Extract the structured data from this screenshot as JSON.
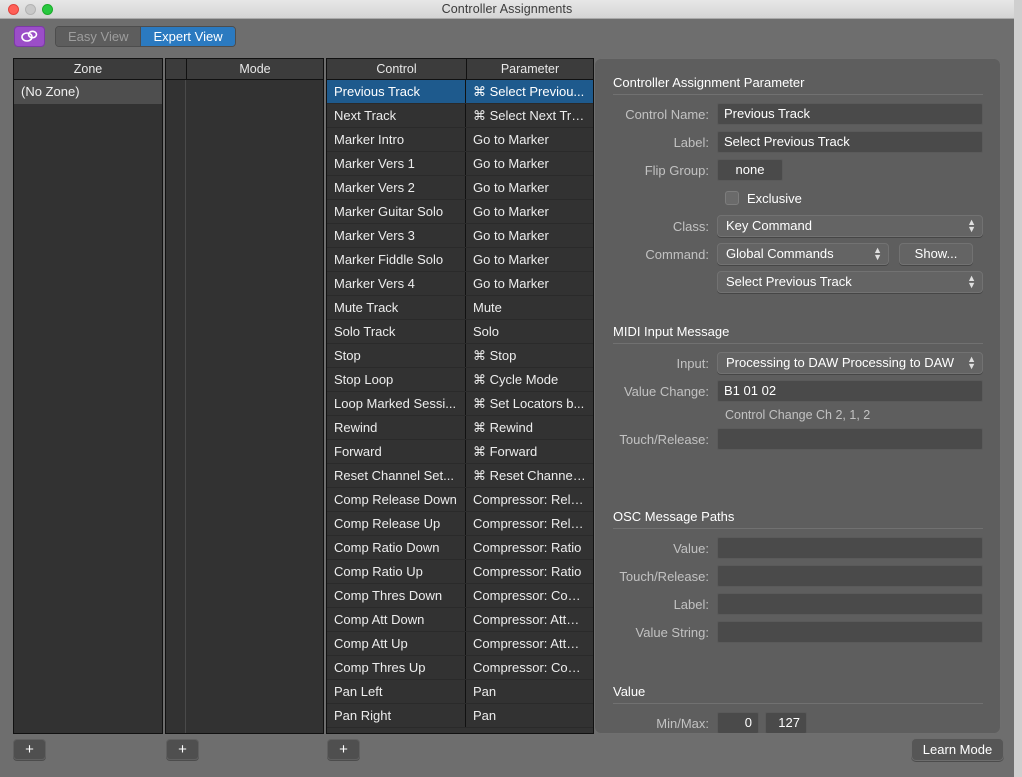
{
  "window": {
    "title": "Controller Assignments"
  },
  "toolbar": {
    "link_icon": "link-icon",
    "easy_view": "Easy View",
    "expert_view": "Expert View"
  },
  "zone_table": {
    "header": "Zone",
    "rows": [
      "(No Zone)"
    ]
  },
  "mode_table": {
    "header": "Mode",
    "rows": []
  },
  "control_table": {
    "headers": {
      "control": "Control",
      "parameter": "Parameter"
    },
    "rows": [
      {
        "control": "Previous Track",
        "parameter": "⌘ Select Previou...",
        "selected": true
      },
      {
        "control": "Next Track",
        "parameter": "⌘ Select Next Tra..."
      },
      {
        "control": "Marker Intro",
        "parameter": "Go to Marker"
      },
      {
        "control": "Marker Vers 1",
        "parameter": "Go to Marker"
      },
      {
        "control": "Marker Vers 2",
        "parameter": "Go to Marker"
      },
      {
        "control": "Marker Guitar Solo",
        "parameter": "Go to Marker"
      },
      {
        "control": "Marker Vers 3",
        "parameter": "Go to Marker"
      },
      {
        "control": "Marker Fiddle Solo",
        "parameter": "Go to Marker"
      },
      {
        "control": "Marker Vers 4",
        "parameter": "Go to Marker"
      },
      {
        "control": "Mute Track",
        "parameter": "Mute"
      },
      {
        "control": "Solo Track",
        "parameter": "Solo"
      },
      {
        "control": "Stop",
        "parameter": "⌘ Stop"
      },
      {
        "control": "Stop Loop",
        "parameter": "⌘ Cycle Mode"
      },
      {
        "control": "Loop Marked Sessi...",
        "parameter": "⌘ Set Locators b..."
      },
      {
        "control": "Rewind",
        "parameter": "⌘ Rewind"
      },
      {
        "control": "Forward",
        "parameter": "⌘ Forward"
      },
      {
        "control": "Reset Channel Set...",
        "parameter": "⌘ Reset Channel..."
      },
      {
        "control": "Comp Release Down",
        "parameter": "Compressor: Rele..."
      },
      {
        "control": "Comp Release Up",
        "parameter": "Compressor: Rele..."
      },
      {
        "control": "Comp Ratio Down",
        "parameter": "Compressor: Ratio"
      },
      {
        "control": "Comp Ratio Up",
        "parameter": "Compressor: Ratio"
      },
      {
        "control": "Comp Thres Down",
        "parameter": "Compressor: Com..."
      },
      {
        "control": "Comp Att Down",
        "parameter": "Compressor: Attack"
      },
      {
        "control": "Comp Att Up",
        "parameter": "Compressor: Attack"
      },
      {
        "control": "Comp Thres Up",
        "parameter": "Compressor: Com..."
      },
      {
        "control": "Pan Left",
        "parameter": "Pan"
      },
      {
        "control": "Pan Right",
        "parameter": "Pan"
      }
    ]
  },
  "panel": {
    "assignment": {
      "title": "Controller Assignment Parameter",
      "control_name_label": "Control Name:",
      "control_name_value": "Previous Track",
      "label_label": "Label:",
      "label_value": "Select Previous Track",
      "flip_group_label": "Flip Group:",
      "flip_group_value": "none",
      "exclusive_label": "Exclusive",
      "class_label": "Class:",
      "class_value": "Key Command",
      "command_label": "Command:",
      "command_value": "Global Commands",
      "show_button": "Show...",
      "command_detail_value": "Select Previous Track"
    },
    "midi": {
      "title": "MIDI Input Message",
      "input_label": "Input:",
      "input_value": "Processing to DAW Processing to DAW",
      "value_change_label": "Value Change:",
      "value_change_value": "B1 01 02",
      "value_change_hint": "Control Change Ch 2, 1, 2",
      "touch_release_label": "Touch/Release:",
      "touch_release_value": ""
    },
    "osc": {
      "title": "OSC Message Paths",
      "value_label": "Value:",
      "value_value": "",
      "touch_release_label": "Touch/Release:",
      "touch_release_value": "",
      "label_label": "Label:",
      "label_value": "",
      "value_string_label": "Value String:",
      "value_string_value": ""
    },
    "value": {
      "title": "Value",
      "minmax_label": "Min/Max:",
      "min": "0",
      "max": "127"
    }
  },
  "bottom": {
    "add_zone": "+",
    "add_mode": "+",
    "add_control": "+",
    "learn_mode": "Learn Mode"
  },
  "colors": {
    "accent_blue": "#2b7ac0",
    "selection_blue": "#1e5a8d",
    "link_purple": "#9b4ec8",
    "window_bg": "#6e6e6e",
    "panel_bg": "#5e5e5e",
    "table_bg": "#323232"
  }
}
